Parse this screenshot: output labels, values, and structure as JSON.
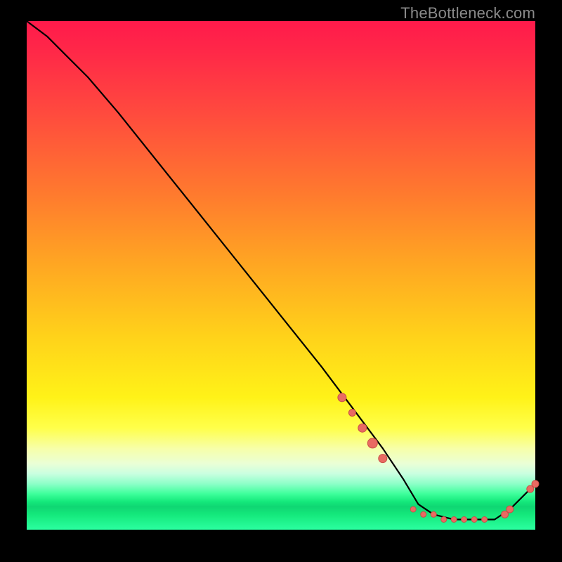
{
  "watermark": "TheBottleneck.com",
  "colors": {
    "curve": "#000000",
    "dot_fill": "#e96a62",
    "dot_stroke": "#c94f47",
    "gradient_top": "#ff1a4b",
    "gradient_bottom": "#2bffa0"
  },
  "chart_data": {
    "type": "line",
    "title": "",
    "xlabel": "",
    "ylabel": "",
    "xlim": [
      0,
      100
    ],
    "ylim": [
      0,
      100
    ],
    "note": "Y value = bottleneck percentage; curve descends from ~100 at x≈0 to ~0 around x≈77–92 then rises slightly. Dots mark samples along the curve near the lower-right.",
    "series": [
      {
        "name": "bottleneck_curve",
        "x": [
          0,
          4,
          8,
          12,
          18,
          26,
          34,
          42,
          50,
          58,
          64,
          70,
          74,
          77,
          80,
          84,
          88,
          92,
          95,
          98,
          100
        ],
        "y": [
          100,
          97,
          93,
          89,
          82,
          72,
          62,
          52,
          42,
          32,
          24,
          16,
          10,
          5,
          3,
          2,
          2,
          2,
          4,
          7,
          9
        ]
      }
    ],
    "dots": {
      "name": "sample_points",
      "x": [
        62,
        64,
        66,
        68,
        70,
        76,
        78,
        80,
        82,
        84,
        86,
        88,
        90,
        94,
        95,
        99,
        100
      ],
      "y": [
        26,
        23,
        20,
        17,
        14,
        4,
        3,
        3,
        2,
        2,
        2,
        2,
        2,
        3,
        4,
        8,
        9
      ],
      "r": [
        6,
        5,
        6,
        7,
        6,
        4,
        4,
        4,
        4,
        4,
        4,
        4,
        4,
        5,
        5,
        5,
        5
      ]
    }
  }
}
